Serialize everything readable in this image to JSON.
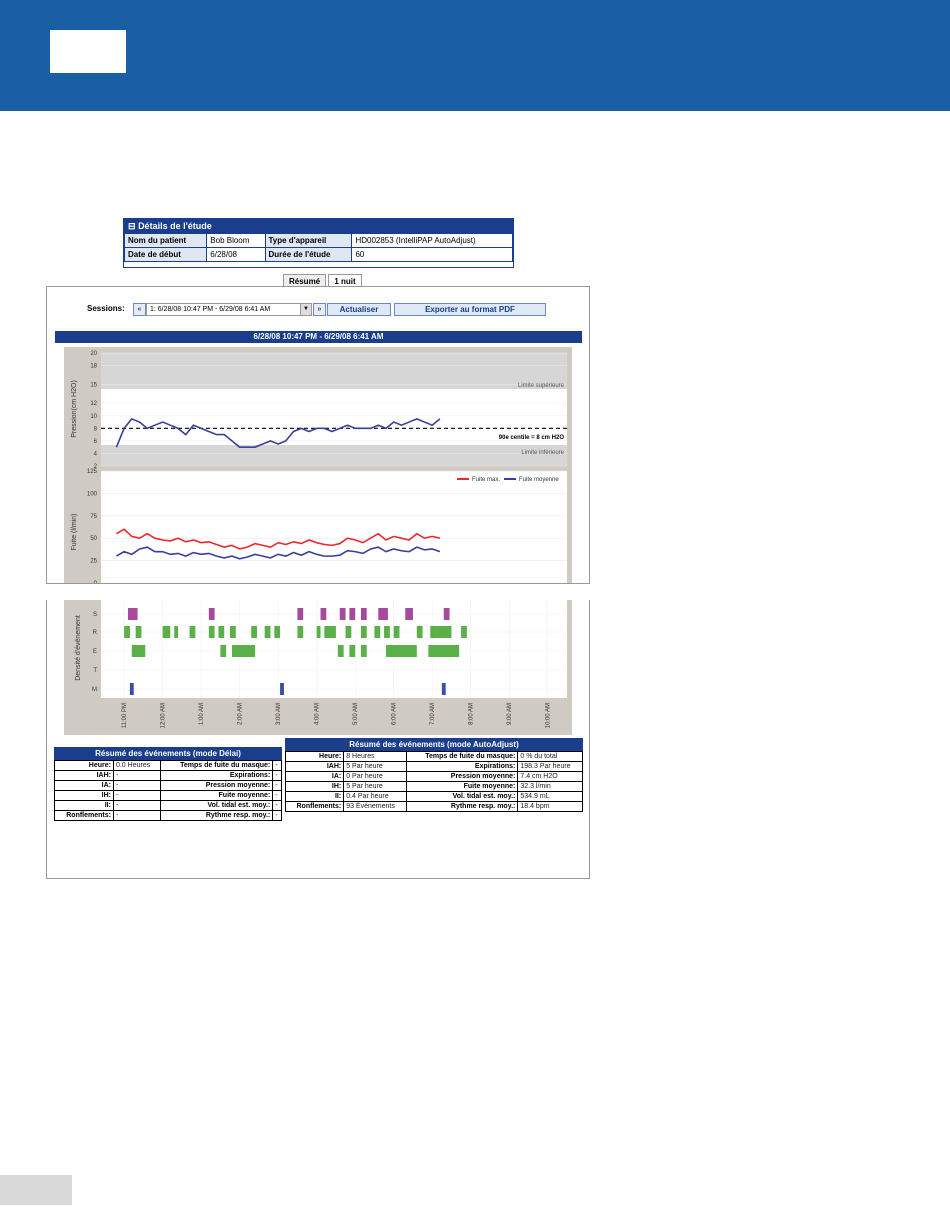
{
  "page": {
    "brand_color": "#1a5fa3",
    "accent": "#1a3d8c"
  },
  "details": {
    "title": "Détails de l'étude",
    "rows": [
      {
        "k1": "Nom du patient",
        "v1": "Bob Bloom",
        "k2": "Type d'appareil",
        "v2": "HD002853 (IntelliPAP AutoAdjust)"
      },
      {
        "k1": "Date de début",
        "v1": "6/28/08",
        "k2": "Durée de l'étude",
        "v2": "60"
      }
    ]
  },
  "tabs": {
    "summary": "Résumé",
    "night": "1 nuit"
  },
  "toolbar": {
    "sessions_label": "Sessions:",
    "prev": "«",
    "next": "»",
    "session_value": "1: 6/28/08 10:47 PM - 6/29/08 6:41 AM",
    "refresh": "Actualiser",
    "export": "Exporter au format PDF"
  },
  "range_title": "6/28/08 10:47 PM - 6/29/08 6:41 AM",
  "pressure_chart": {
    "ylabel": "Pression(cm H2O)",
    "yticks": [
      "20",
      "18",
      "15",
      "12",
      "10",
      "8",
      "6",
      "4",
      "2"
    ],
    "upper_label": "Limite supérieure",
    "lower_label": "Limite inférieure",
    "p90_label": "90e centile = 8 cm H2O"
  },
  "leak_chart": {
    "ylabel": "Fuite (l/min)",
    "yticks": [
      "125",
      "100",
      "75",
      "50",
      "25",
      "0"
    ],
    "legend": {
      "max": "Fuite max.",
      "avg": "Fuite moyenne"
    },
    "colors": {
      "max": "#e8292e",
      "avg": "#3a3f9c"
    }
  },
  "events_chart": {
    "ylabel": "Densité d'événement",
    "rows": [
      "S",
      "R",
      "E",
      "T",
      "M"
    ],
    "xticks": [
      "11:00 PM",
      "12:00 AM",
      "1:00 AM",
      "2:00 AM",
      "3:00 AM",
      "4:00 AM",
      "5:00 AM",
      "6:00 AM",
      "7:00 AM",
      "8:00 AM",
      "9:00 AM",
      "10:00 AM"
    ]
  },
  "chart_data": [
    {
      "type": "line",
      "x_unit": "hours after 11:00 PM",
      "x": [
        -0.2,
        0,
        0.2,
        0.4,
        0.6,
        0.8,
        1,
        1.2,
        1.4,
        1.6,
        1.8,
        2,
        2.2,
        2.4,
        2.6,
        2.8,
        3,
        3.2,
        3.4,
        3.6,
        3.8,
        4,
        4.2,
        4.4,
        4.6,
        4.8,
        5,
        5.2,
        5.4,
        5.6,
        5.8,
        6,
        6.2,
        6.4,
        6.6,
        6.8,
        7.0,
        7.2,
        7.4,
        7.6,
        7.8,
        8.0,
        8.2
      ],
      "series": [
        {
          "values": [
            5,
            8,
            9.5,
            9,
            8,
            8.5,
            9,
            8.5,
            8,
            7,
            8.5,
            8,
            7.5,
            7,
            7,
            6,
            5,
            5,
            5,
            5.5,
            6,
            5.5,
            6,
            7.5,
            8,
            7.5,
            8,
            8,
            7.5,
            8,
            8.5,
            8,
            8,
            8,
            8.5,
            8,
            9,
            8.5,
            9,
            9.5,
            9,
            8.5,
            9.5
          ]
        }
      ],
      "ylabel": "Pression(cm H2O)",
      "ylim": [
        2,
        20
      ],
      "reference_line": 8
    },
    {
      "type": "line",
      "x_unit": "hours after 11:00 PM",
      "ylabel": "Fuite (l/min)",
      "ylim": [
        0,
        125
      ],
      "series": [
        {
          "name": "Fuite max.",
          "values": [
            55,
            60,
            52,
            50,
            55,
            50,
            48,
            47,
            50,
            46,
            48,
            45,
            46,
            43,
            40,
            42,
            38,
            40,
            44,
            42,
            40,
            45,
            43,
            46,
            44,
            48,
            45,
            43,
            42,
            44,
            50,
            48,
            45,
            50,
            55,
            48,
            52,
            50,
            48,
            55,
            50,
            52,
            50
          ]
        },
        {
          "name": "Fuite moyenne",
          "values": [
            30,
            35,
            32,
            38,
            40,
            35,
            35,
            32,
            33,
            30,
            34,
            32,
            33,
            30,
            28,
            30,
            27,
            29,
            32,
            30,
            28,
            32,
            30,
            34,
            31,
            35,
            32,
            30,
            30,
            31,
            36,
            35,
            33,
            38,
            40,
            35,
            38,
            36,
            35,
            40,
            37,
            38,
            35
          ]
        }
      ]
    },
    {
      "type": "bar",
      "x_unit": "hours after 11:00 PM",
      "categories": [
        "S",
        "R",
        "E",
        "T",
        "M"
      ],
      "series": [
        {
          "name": "S",
          "events": [
            [
              0.1,
              0.35
            ],
            [
              2.2,
              2.35
            ],
            [
              4.5,
              4.65
            ],
            [
              5.1,
              5.25
            ],
            [
              5.6,
              5.75
            ],
            [
              5.85,
              6.0
            ],
            [
              6.15,
              6.3
            ],
            [
              6.6,
              6.85
            ],
            [
              7.3,
              7.5
            ],
            [
              8.3,
              8.45
            ]
          ]
        },
        {
          "name": "R",
          "events": [
            [
              0,
              0.15
            ],
            [
              0.3,
              0.45
            ],
            [
              1.0,
              1.2
            ],
            [
              1.3,
              1.4
            ],
            [
              1.7,
              1.85
            ],
            [
              2.2,
              2.35
            ],
            [
              2.45,
              2.6
            ],
            [
              2.75,
              2.9
            ],
            [
              3.3,
              3.45
            ],
            [
              3.65,
              3.8
            ],
            [
              3.9,
              4.05
            ],
            [
              4.5,
              4.65
            ],
            [
              5.0,
              5.1
            ],
            [
              5.2,
              5.5
            ],
            [
              5.75,
              5.9
            ],
            [
              6.15,
              6.3
            ],
            [
              6.5,
              6.65
            ],
            [
              6.75,
              6.9
            ],
            [
              7.0,
              7.15
            ],
            [
              7.6,
              7.75
            ],
            [
              7.95,
              8.5
            ],
            [
              8.75,
              8.9
            ]
          ]
        },
        {
          "name": "E",
          "events": [
            [
              0.2,
              0.55
            ],
            [
              2.5,
              2.65
            ],
            [
              2.8,
              3.4
            ],
            [
              5.55,
              5.7
            ],
            [
              5.85,
              6.0
            ],
            [
              6.15,
              6.3
            ],
            [
              6.8,
              7.6
            ],
            [
              7.9,
              8.7
            ]
          ]
        },
        {
          "name": "T",
          "events": []
        },
        {
          "name": "M",
          "events": [
            [
              0.15,
              0.25
            ],
            [
              4.05,
              4.15
            ],
            [
              8.25,
              8.35
            ]
          ]
        }
      ]
    }
  ],
  "delay_summary": {
    "title": "Résumé des événements (mode Délai)",
    "rows": [
      {
        "k1": "Heure:",
        "v1": "0.0 Heures",
        "k2": "Temps de fuite du masque:",
        "v2": "-"
      },
      {
        "k1": "IAH:",
        "v1": "-",
        "k2": "Expirations:",
        "v2": "-"
      },
      {
        "k1": "IA:",
        "v1": "-",
        "k2": "Pression moyenne:",
        "v2": "-"
      },
      {
        "k1": "IH:",
        "v1": "-",
        "k2": "Fuite moyenne:",
        "v2": "-"
      },
      {
        "k1": "II:",
        "v1": "-",
        "k2": "Vol. tidal est. moy.:",
        "v2": "-"
      },
      {
        "k1": "Ronflements:",
        "v1": "-",
        "k2": "Rythme resp. moy.:",
        "v2": "-"
      }
    ]
  },
  "auto_summary": {
    "title": "Résumé des événements (mode AutoAdjust)",
    "rows": [
      {
        "k1": "Heure:",
        "v1": "8 Heures",
        "k2": "Temps de fuite du masque:",
        "v2": "0 % du total"
      },
      {
        "k1": "IAH:",
        "v1": "5 Par heure",
        "k2": "Expirations:",
        "v2": "198.3 Par heure"
      },
      {
        "k1": "IA:",
        "v1": "0 Par heure",
        "k2": "Pression moyenne:",
        "v2": "7.4 cm H2O"
      },
      {
        "k1": "IH:",
        "v1": "5 Par heure",
        "k2": "Fuite moyenne:",
        "v2": "32.3 l/min"
      },
      {
        "k1": "II:",
        "v1": "0.4 Par heure",
        "k2": "Vol. tidal est. moy.:",
        "v2": "534.9 mL"
      },
      {
        "k1": "Ronflements:",
        "v1": "93 Événements",
        "k2": "Rythme resp. moy.:",
        "v2": "18.4 bpm"
      }
    ]
  }
}
